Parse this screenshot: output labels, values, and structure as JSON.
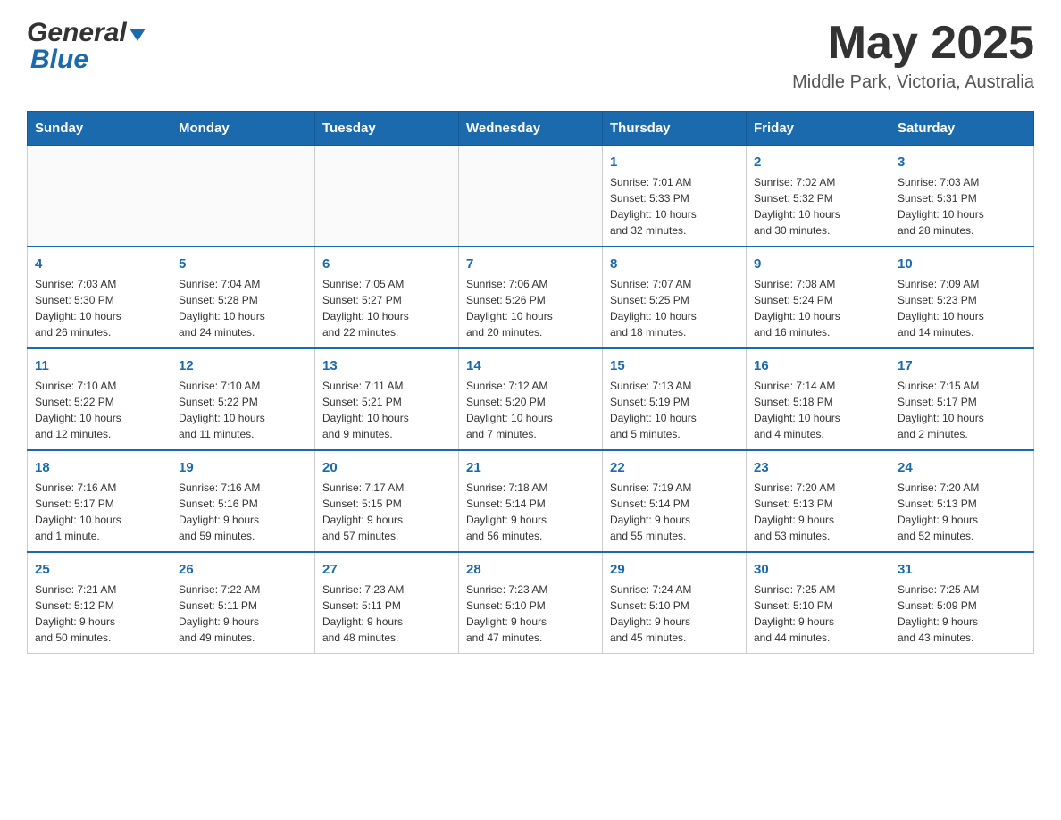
{
  "header": {
    "logo_general": "General",
    "logo_blue": "Blue",
    "month_title": "May 2025",
    "location": "Middle Park, Victoria, Australia"
  },
  "days_of_week": [
    "Sunday",
    "Monday",
    "Tuesday",
    "Wednesday",
    "Thursday",
    "Friday",
    "Saturday"
  ],
  "weeks": [
    {
      "days": [
        {
          "num": "",
          "info": ""
        },
        {
          "num": "",
          "info": ""
        },
        {
          "num": "",
          "info": ""
        },
        {
          "num": "",
          "info": ""
        },
        {
          "num": "1",
          "info": "Sunrise: 7:01 AM\nSunset: 5:33 PM\nDaylight: 10 hours\nand 32 minutes."
        },
        {
          "num": "2",
          "info": "Sunrise: 7:02 AM\nSunset: 5:32 PM\nDaylight: 10 hours\nand 30 minutes."
        },
        {
          "num": "3",
          "info": "Sunrise: 7:03 AM\nSunset: 5:31 PM\nDaylight: 10 hours\nand 28 minutes."
        }
      ]
    },
    {
      "days": [
        {
          "num": "4",
          "info": "Sunrise: 7:03 AM\nSunset: 5:30 PM\nDaylight: 10 hours\nand 26 minutes."
        },
        {
          "num": "5",
          "info": "Sunrise: 7:04 AM\nSunset: 5:28 PM\nDaylight: 10 hours\nand 24 minutes."
        },
        {
          "num": "6",
          "info": "Sunrise: 7:05 AM\nSunset: 5:27 PM\nDaylight: 10 hours\nand 22 minutes."
        },
        {
          "num": "7",
          "info": "Sunrise: 7:06 AM\nSunset: 5:26 PM\nDaylight: 10 hours\nand 20 minutes."
        },
        {
          "num": "8",
          "info": "Sunrise: 7:07 AM\nSunset: 5:25 PM\nDaylight: 10 hours\nand 18 minutes."
        },
        {
          "num": "9",
          "info": "Sunrise: 7:08 AM\nSunset: 5:24 PM\nDaylight: 10 hours\nand 16 minutes."
        },
        {
          "num": "10",
          "info": "Sunrise: 7:09 AM\nSunset: 5:23 PM\nDaylight: 10 hours\nand 14 minutes."
        }
      ]
    },
    {
      "days": [
        {
          "num": "11",
          "info": "Sunrise: 7:10 AM\nSunset: 5:22 PM\nDaylight: 10 hours\nand 12 minutes."
        },
        {
          "num": "12",
          "info": "Sunrise: 7:10 AM\nSunset: 5:22 PM\nDaylight: 10 hours\nand 11 minutes."
        },
        {
          "num": "13",
          "info": "Sunrise: 7:11 AM\nSunset: 5:21 PM\nDaylight: 10 hours\nand 9 minutes."
        },
        {
          "num": "14",
          "info": "Sunrise: 7:12 AM\nSunset: 5:20 PM\nDaylight: 10 hours\nand 7 minutes."
        },
        {
          "num": "15",
          "info": "Sunrise: 7:13 AM\nSunset: 5:19 PM\nDaylight: 10 hours\nand 5 minutes."
        },
        {
          "num": "16",
          "info": "Sunrise: 7:14 AM\nSunset: 5:18 PM\nDaylight: 10 hours\nand 4 minutes."
        },
        {
          "num": "17",
          "info": "Sunrise: 7:15 AM\nSunset: 5:17 PM\nDaylight: 10 hours\nand 2 minutes."
        }
      ]
    },
    {
      "days": [
        {
          "num": "18",
          "info": "Sunrise: 7:16 AM\nSunset: 5:17 PM\nDaylight: 10 hours\nand 1 minute."
        },
        {
          "num": "19",
          "info": "Sunrise: 7:16 AM\nSunset: 5:16 PM\nDaylight: 9 hours\nand 59 minutes."
        },
        {
          "num": "20",
          "info": "Sunrise: 7:17 AM\nSunset: 5:15 PM\nDaylight: 9 hours\nand 57 minutes."
        },
        {
          "num": "21",
          "info": "Sunrise: 7:18 AM\nSunset: 5:14 PM\nDaylight: 9 hours\nand 56 minutes."
        },
        {
          "num": "22",
          "info": "Sunrise: 7:19 AM\nSunset: 5:14 PM\nDaylight: 9 hours\nand 55 minutes."
        },
        {
          "num": "23",
          "info": "Sunrise: 7:20 AM\nSunset: 5:13 PM\nDaylight: 9 hours\nand 53 minutes."
        },
        {
          "num": "24",
          "info": "Sunrise: 7:20 AM\nSunset: 5:13 PM\nDaylight: 9 hours\nand 52 minutes."
        }
      ]
    },
    {
      "days": [
        {
          "num": "25",
          "info": "Sunrise: 7:21 AM\nSunset: 5:12 PM\nDaylight: 9 hours\nand 50 minutes."
        },
        {
          "num": "26",
          "info": "Sunrise: 7:22 AM\nSunset: 5:11 PM\nDaylight: 9 hours\nand 49 minutes."
        },
        {
          "num": "27",
          "info": "Sunrise: 7:23 AM\nSunset: 5:11 PM\nDaylight: 9 hours\nand 48 minutes."
        },
        {
          "num": "28",
          "info": "Sunrise: 7:23 AM\nSunset: 5:10 PM\nDaylight: 9 hours\nand 47 minutes."
        },
        {
          "num": "29",
          "info": "Sunrise: 7:24 AM\nSunset: 5:10 PM\nDaylight: 9 hours\nand 45 minutes."
        },
        {
          "num": "30",
          "info": "Sunrise: 7:25 AM\nSunset: 5:10 PM\nDaylight: 9 hours\nand 44 minutes."
        },
        {
          "num": "31",
          "info": "Sunrise: 7:25 AM\nSunset: 5:09 PM\nDaylight: 9 hours\nand 43 minutes."
        }
      ]
    }
  ]
}
